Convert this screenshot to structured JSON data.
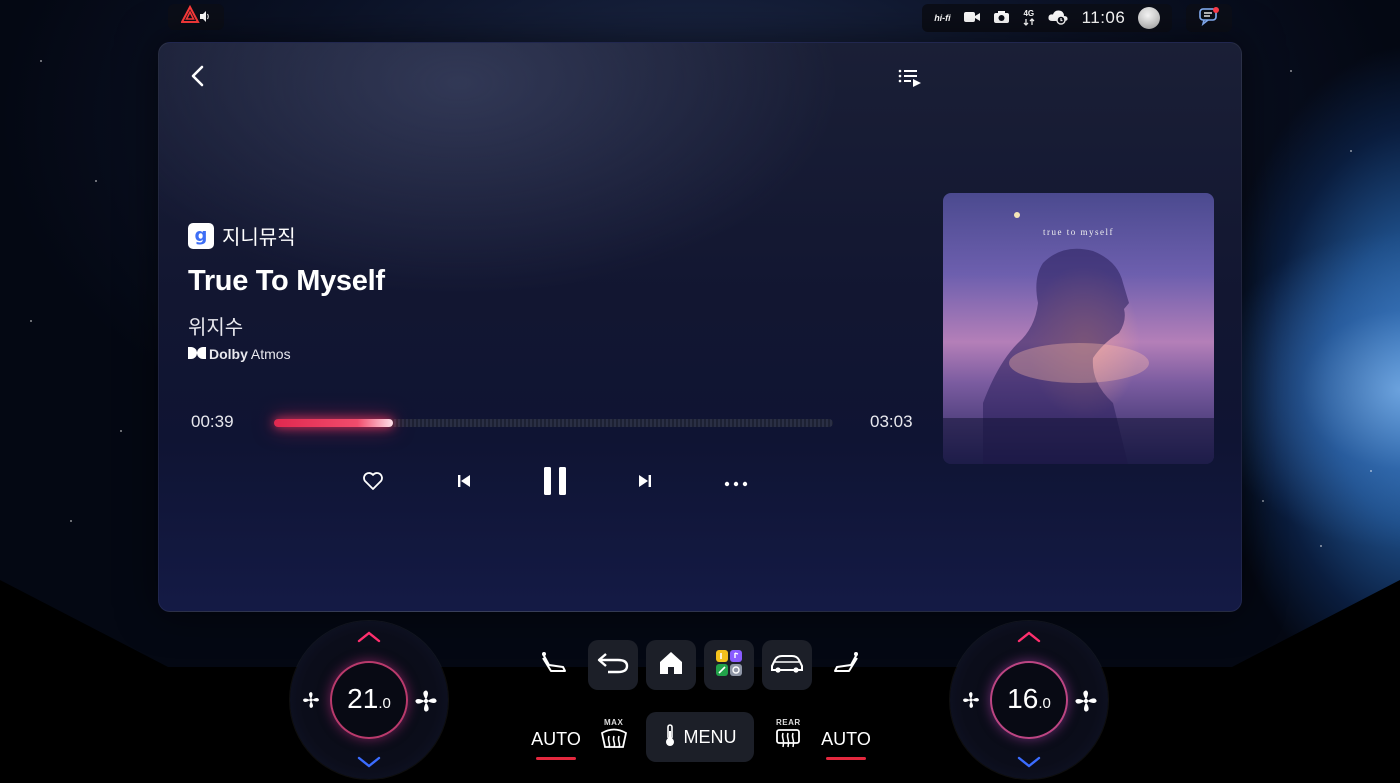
{
  "status_bar": {
    "time": "11:06",
    "hifi_label": "hi-fi",
    "network_label": "4G",
    "icons": [
      "hazard-warning-icon",
      "camera-video-icon",
      "camera-icon",
      "network-4g-icon",
      "cloud-sync-icon",
      "user-avatar",
      "message-icon"
    ]
  },
  "player": {
    "source_logo": "g",
    "source_name": "지니뮤직",
    "title": "True To Myself",
    "artist": "위지수",
    "format_brand": "Dolby",
    "format_name": "Atmos",
    "current_time": "00:39",
    "total_time": "03:03",
    "progress": 0.2131,
    "album_art_text": "true to myself"
  },
  "climate": {
    "left_temp_int": "21",
    "left_temp_dec": ".0",
    "right_temp_int": "16",
    "right_temp_dec": ".0",
    "left_auto": "AUTO",
    "right_auto": "AUTO",
    "defrost_label": "MAX",
    "rear_label": "REAR",
    "menu_label": "MENU"
  },
  "colors": {
    "accent": "#e4283e",
    "progress": "#f14c6c",
    "panel_bg": "#121631"
  }
}
